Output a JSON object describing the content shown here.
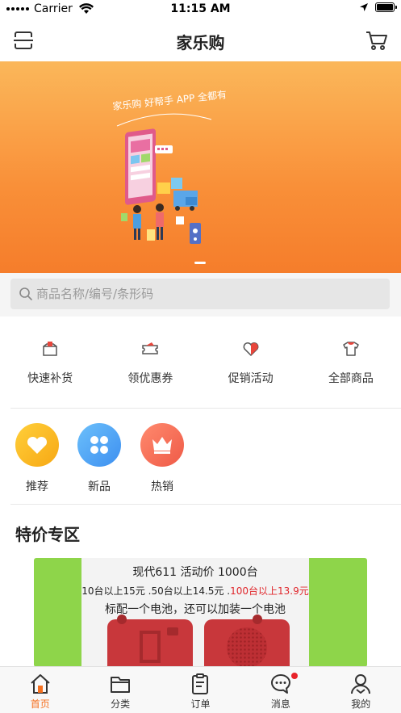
{
  "status_bar": {
    "carrier": "Carrier",
    "time": "11:15 AM",
    "battery_level": 1.0
  },
  "nav": {
    "title": "家乐购",
    "left_icon": "scan-icon",
    "right_icon": "cart-icon"
  },
  "banner": {
    "slogan": "家乐购 好帮手 APP 全都有",
    "active_slide": 1,
    "colors": {
      "top": "#fbb75a",
      "bottom": "#f57d2b"
    }
  },
  "search": {
    "placeholder": "商品名称/编号/条形码"
  },
  "quick_actions": [
    {
      "label": "快速补货",
      "icon": "restock-box-icon"
    },
    {
      "label": "领优惠券",
      "icon": "coupon-icon"
    },
    {
      "label": "促销活动",
      "icon": "promotion-heart-icon"
    },
    {
      "label": "全部商品",
      "icon": "shirt-icon"
    }
  ],
  "categories": [
    {
      "label": "推荐",
      "icon": "heart-icon",
      "color": "#fbb823"
    },
    {
      "label": "新品",
      "icon": "clover-icon",
      "color": "#4aa3f2"
    },
    {
      "label": "热销",
      "icon": "crown-icon",
      "color": "#f46a52"
    }
  ],
  "special": {
    "title": "特价专区",
    "promo_line1": "现代611 活动价 1000台",
    "promo_line2a": "10台以上15元 .50台以上14.5元 .",
    "promo_line2b": "100台以上13.9元",
    "promo_line3": "标配一个电池，还可以加装一个电池"
  },
  "tab_bar": [
    {
      "label": "首页",
      "icon": "home-icon",
      "active": true
    },
    {
      "label": "分类",
      "icon": "category-folder-icon",
      "active": false
    },
    {
      "label": "订单",
      "icon": "order-clipboard-icon",
      "active": false
    },
    {
      "label": "消息",
      "icon": "message-bubble-icon",
      "active": false,
      "badge": true
    },
    {
      "label": "我的",
      "icon": "profile-icon",
      "active": false
    }
  ],
  "accent_color": "#f5701f"
}
